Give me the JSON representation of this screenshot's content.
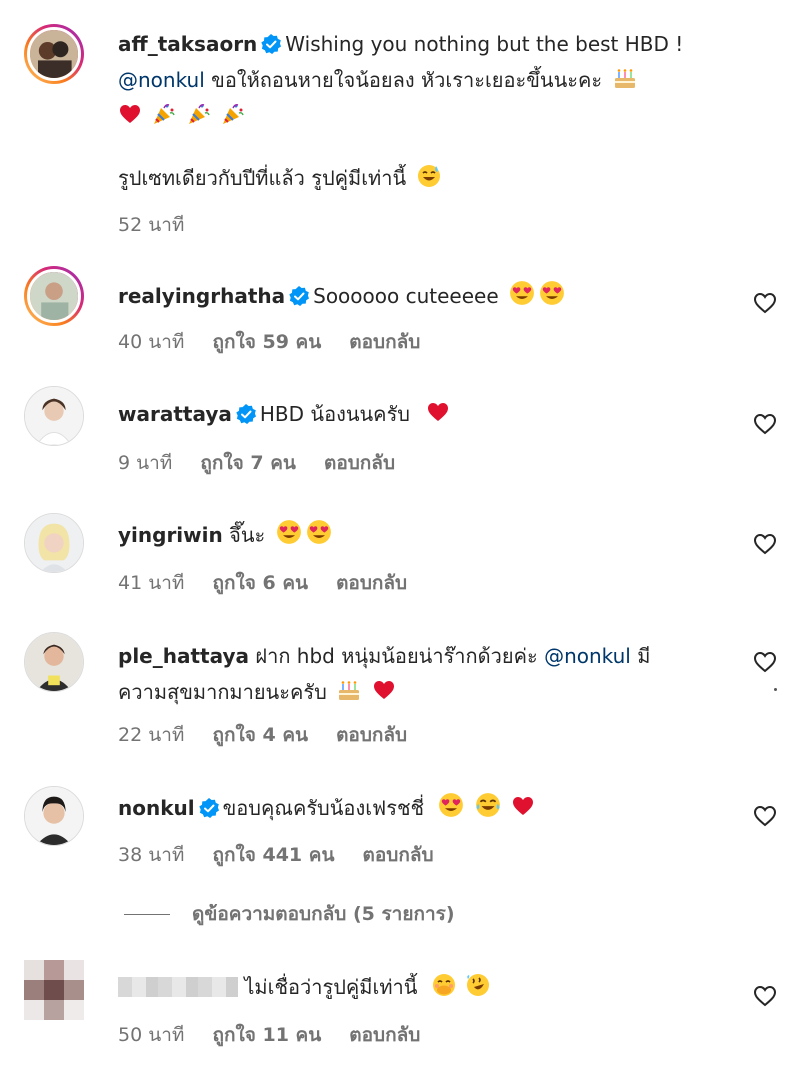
{
  "comments": [
    {
      "username": "aff_taksaorn",
      "text_lines": [
        "Wishing you nothing but the best HBD !"
      ],
      "mention": "@nonkul",
      "line2": "ขอให้ถอนหายใจน้อยลง หัวเราะเยอะขึ้นนะคะ",
      "extra": "รูปเซทเดียวกับปีที่แล้ว รูปคู่มีเท่านี้",
      "time": "52 นาที"
    },
    {
      "username": "realyingrhatha",
      "text": "Soooooo cuteeeee",
      "time": "40 นาที",
      "likes": "ถูกใจ 59 คน",
      "reply": "ตอบกลับ"
    },
    {
      "username": "warattaya",
      "text": "HBD น้องนนครับ",
      "time": "9 นาที",
      "likes": "ถูกใจ 7 คน",
      "reply": "ตอบกลับ"
    },
    {
      "username": "yingriwin",
      "text": "จึ๊นะ",
      "time": "41 นาที",
      "likes": "ถูกใจ 6 คน",
      "reply": "ตอบกลับ"
    },
    {
      "username": "ple_hattaya",
      "text": "ฝาก hbd หนุ่มน้อยน่าร๊ากด้วยค่ะ",
      "mention": "@nonkul",
      "text_after": "มี",
      "line2": "ความสุขมากมายนะครับ",
      "time": "22 นาที",
      "likes": "ถูกใจ 4 คน",
      "reply": "ตอบกลับ"
    },
    {
      "username": "nonkul",
      "text": "ขอบคุณครับน้องเฟรชชี่",
      "time": "38 นาที",
      "likes": "ถูกใจ 441 คน",
      "reply": "ตอบกลับ"
    },
    {
      "username": "",
      "text": "ไม่เชื่อว่ารูปคู่มีเท่านี้",
      "time": "50 นาที",
      "likes": "ถูกใจ 11 คน",
      "reply": "ตอบกลับ"
    }
  ],
  "view_replies": "ดูข้อความตอบกลับ (5 รายการ)",
  "colors": {
    "verified": "#0095f6",
    "heart_red": "#ed4956",
    "mention": "#00376b",
    "meta": "#737373"
  },
  "icons": [
    "verified-badge-icon",
    "heart-outline-icon",
    "heart-emoji-icon",
    "party-popper-icon",
    "birthday-cake-icon",
    "heart-eyes-emoji-icon",
    "grinning-sweat-emoji-icon",
    "tears-of-joy-emoji-icon",
    "rolling-laughing-emoji-icon",
    "shy-hand-over-mouth-emoji-icon"
  ]
}
